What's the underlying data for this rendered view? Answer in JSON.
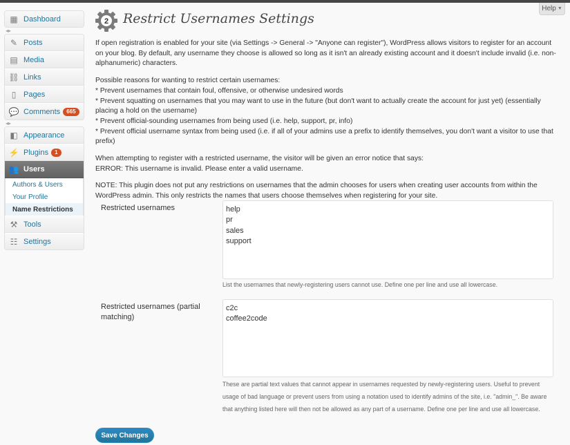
{
  "help_label": "Help",
  "menu": {
    "dashboard": "Dashboard",
    "posts": "Posts",
    "media": "Media",
    "links": "Links",
    "pages": "Pages",
    "comments": "Comments",
    "comments_count": "665",
    "appearance": "Appearance",
    "plugins": "Plugins",
    "plugins_count": "1",
    "users": "Users",
    "users_sub": [
      "Authors & Users",
      "Your Profile",
      "Name Restrictions"
    ],
    "tools": "Tools",
    "settings": "Settings"
  },
  "page": {
    "title": "Restrict Usernames Settings",
    "gear_number": "2",
    "intro": "If open registration is enabled for your site (via Settings -> General -> \"Anyone can register\"), WordPress allows visitors to register for an account on your blog. By default, any username they choose is allowed so long as it isn't an already existing account and it doesn't include invalid (i.e. non-alphanumeric) characters.",
    "reasons_title": "Possible reasons for wanting to restrict certain usernames:",
    "reasons": [
      "* Prevent usernames that contain foul, offensive, or otherwise undesired words",
      "* Prevent squatting on usernames that you may want to use in the future (but don't want to actually create the account for just yet) (essentially placing a hold on the username)",
      "* Prevent official-sounding usernames from being used (i.e. help, support, pr, info)",
      "* Prevent official username syntax from being used (i.e. if all of your admins use a prefix to identify themselves, you don't want a visitor to use that prefix)"
    ],
    "error_intro": "When attempting to register with a restricted username, the visitor will be given an error notice that says:",
    "error_text": "ERROR: This username is invalid. Please enter a valid username.",
    "note": "NOTE: This plugin does not put any restrictions on usernames that the admin chooses for users when creating user accounts from within the WordPress admin. This only restricts the names that users choose themselves when registering for your site."
  },
  "fields": {
    "restricted_label": "Restricted usernames",
    "restricted_values": [
      "help",
      "pr",
      "sales",
      "support"
    ],
    "restricted_desc": "List the usernames that newly-registering users cannot use. Define one per line and use all lowercase.",
    "partial_label": "Restricted usernames (partial matching)",
    "partial_values": [
      "c2c",
      "coffee2code"
    ],
    "partial_desc": "These are partial text values that cannot appear in usernames requested by newly-registering users. Useful to prevent usage of bad language or prevent users from using a notation used to identify admins of the site, i.e. \"admin_\". Be aware that anything listed here will then not be allowed as any part of a username. Define one per line and use all lowercase."
  },
  "save_label": "Save Changes",
  "colors": {
    "link": "#21759b",
    "badge": "#d54e21",
    "button": "#21759b"
  }
}
